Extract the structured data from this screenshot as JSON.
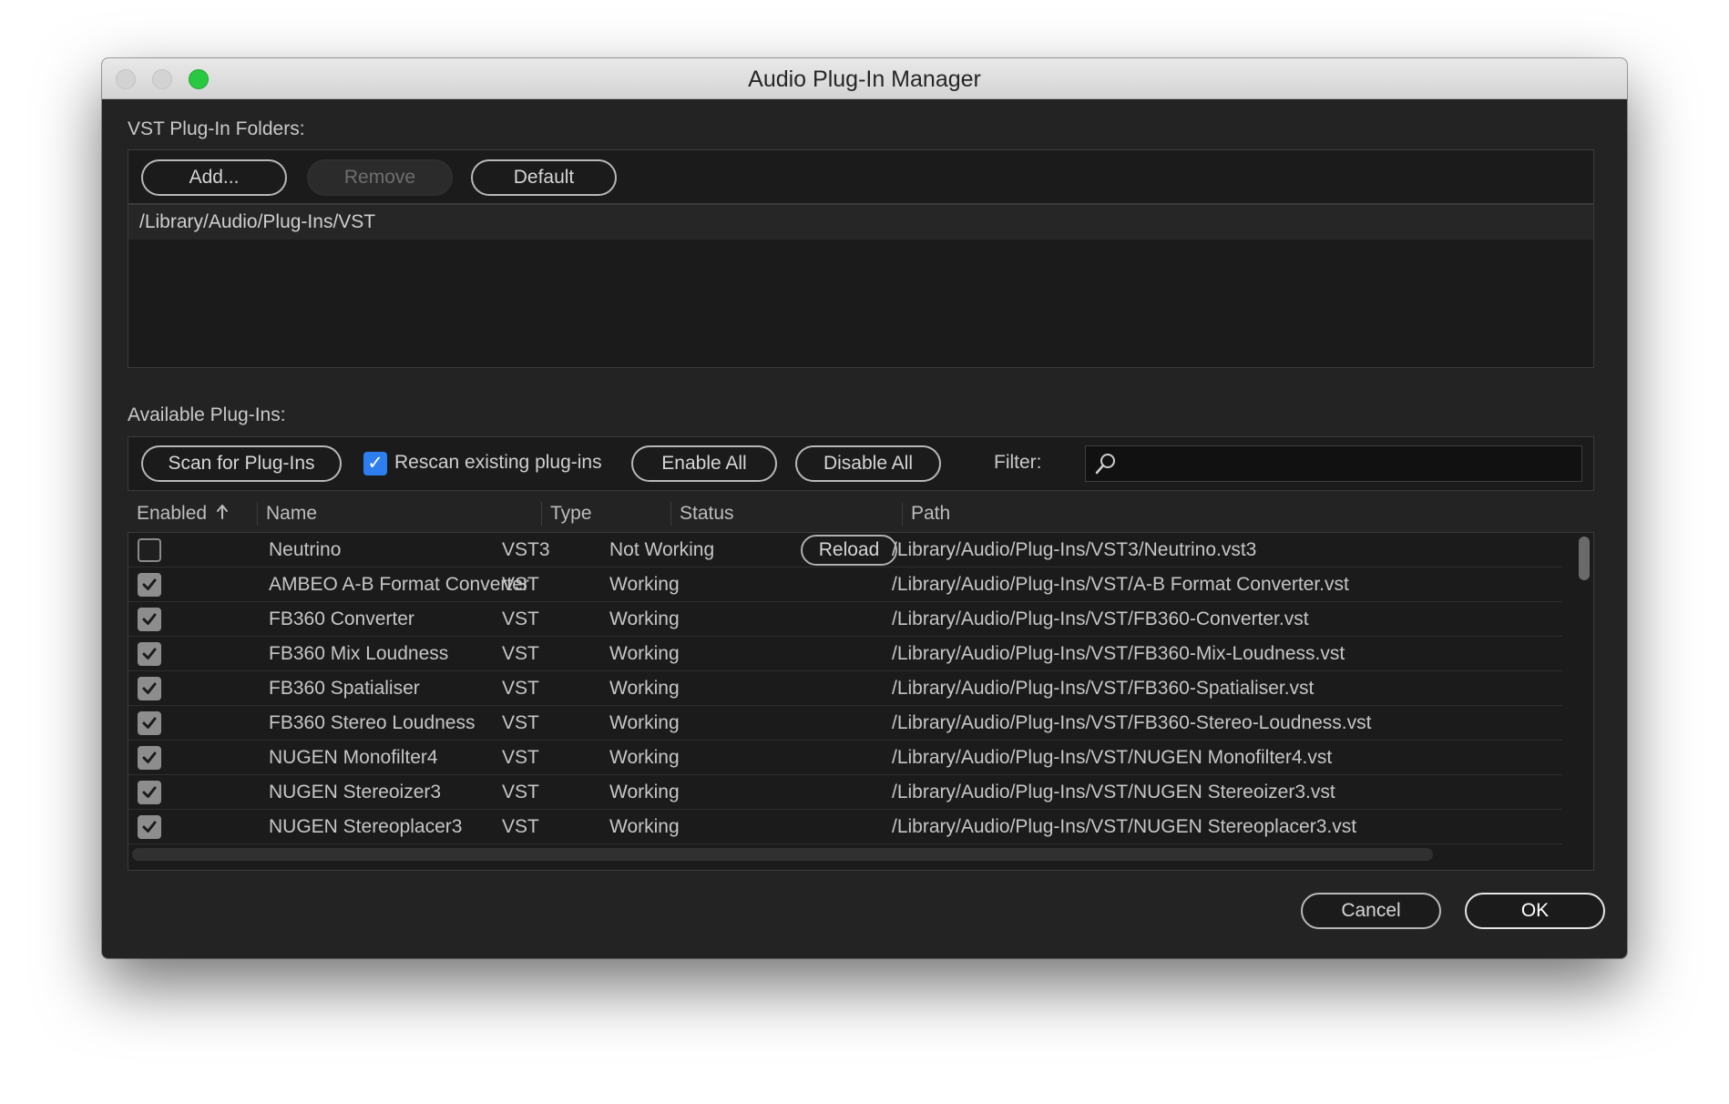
{
  "window": {
    "title": "Audio Plug-In Manager",
    "traffic_lights": [
      "close",
      "minimize",
      "zoom"
    ]
  },
  "folders": {
    "section_label": "VST Plug-In Folders:",
    "add_label": "Add...",
    "remove_label": "Remove",
    "default_label": "Default",
    "items": [
      "/Library/Audio/Plug-Ins/VST"
    ]
  },
  "plugins": {
    "section_label": "Available Plug-Ins:",
    "scan_label": "Scan for Plug-Ins",
    "rescan_label": "Rescan existing plug-ins",
    "rescan_checked": true,
    "enable_all_label": "Enable All",
    "disable_all_label": "Disable All",
    "filter_label": "Filter:",
    "filter_value": "",
    "columns": {
      "enabled": "Enabled",
      "sort_icon": "sort-up-arrow-icon",
      "name": "Name",
      "type": "Type",
      "status": "Status",
      "path": "Path"
    },
    "reload_label": "Reload",
    "rows": [
      {
        "enabled": false,
        "name": "Neutrino",
        "type": "VST3",
        "status": "Not Working",
        "path": "/Library/Audio/Plug-Ins/VST3/Neutrino.vst3"
      },
      {
        "enabled": true,
        "name": "AMBEO A-B Format Converter",
        "type": "VST",
        "status": "Working",
        "path": "/Library/Audio/Plug-Ins/VST/A-B Format Converter.vst"
      },
      {
        "enabled": true,
        "name": "FB360 Converter",
        "type": "VST",
        "status": "Working",
        "path": "/Library/Audio/Plug-Ins/VST/FB360-Converter.vst"
      },
      {
        "enabled": true,
        "name": "FB360 Mix Loudness",
        "type": "VST",
        "status": "Working",
        "path": "/Library/Audio/Plug-Ins/VST/FB360-Mix-Loudness.vst"
      },
      {
        "enabled": true,
        "name": "FB360 Spatialiser",
        "type": "VST",
        "status": "Working",
        "path": "/Library/Audio/Plug-Ins/VST/FB360-Spatialiser.vst"
      },
      {
        "enabled": true,
        "name": "FB360 Stereo Loudness",
        "type": "VST",
        "status": "Working",
        "path": "/Library/Audio/Plug-Ins/VST/FB360-Stereo-Loudness.vst"
      },
      {
        "enabled": true,
        "name": "NUGEN Monofilter4",
        "type": "VST",
        "status": "Working",
        "path": "/Library/Audio/Plug-Ins/VST/NUGEN Monofilter4.vst"
      },
      {
        "enabled": true,
        "name": "NUGEN Stereoizer3",
        "type": "VST",
        "status": "Working",
        "path": "/Library/Audio/Plug-Ins/VST/NUGEN Stereoizer3.vst"
      },
      {
        "enabled": true,
        "name": "NUGEN Stereoplacer3",
        "type": "VST",
        "status": "Working",
        "path": "/Library/Audio/Plug-Ins/VST/NUGEN Stereoplacer3.vst"
      }
    ]
  },
  "footer": {
    "cancel_label": "Cancel",
    "ok_label": "OK"
  },
  "colors": {
    "window_bg": "#232323",
    "accent_checkbox": "#2d7ff0",
    "zoom_button": "#28c840"
  }
}
